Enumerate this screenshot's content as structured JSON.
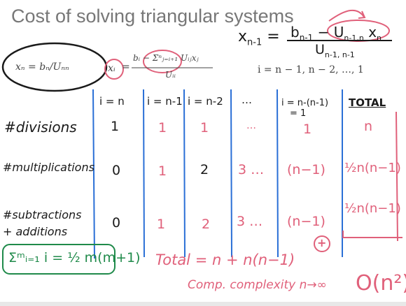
{
  "slide": {
    "title": "Cost of solving triangular systems",
    "top_formula": {
      "lhs": "x",
      "lhs_sub": "n-1",
      "numerator": "b",
      "numerator_sub": "n-1",
      "minus": "−",
      "num_U": "U",
      "num_U_sub": "n-1,n",
      "num_x": "x",
      "num_x_sub": "n",
      "denominator": "U",
      "denominator_sub": "n-1, n-1"
    },
    "formula_xn": "xₙ = bₙ/Uₙₙ",
    "formula_xi_lhs": "xᵢ",
    "formula_xi_num": "bᵢ − Σⁿⱼ₌ᵢ₊₁ Uᵢⱼxⱼ",
    "formula_xi_den": "Uᵢᵢ",
    "formula_range": "i = n − 1, n − 2, …, 1",
    "headers": [
      "i = n",
      "i = n-1",
      "i = n-2",
      "…",
      "i = n-(n-1)",
      "TOTAL"
    ],
    "header_sub": "= 1",
    "rows": [
      {
        "label": "#divisions",
        "cells": [
          "1",
          "1",
          "1",
          "…",
          "1",
          "n"
        ]
      },
      {
        "label": "#multiplications",
        "cells": [
          "0",
          "1",
          "2",
          "3 …",
          "(n−1)",
          "½n(n−1)"
        ]
      },
      {
        "label": "#subtractions",
        "label2": "+ additions",
        "cells": [
          "0",
          "1",
          "2",
          "3 …",
          "(n−1)",
          "½n(n−1)"
        ]
      }
    ],
    "plus_mark": "+",
    "sum_formula": "Σᵐᵢ₌₁ i = ½ m(m+1)",
    "total_line": "Total = n + n(n−1)",
    "complexity_line": "Comp. complexity n→∞",
    "big_o": "O(n²)",
    "colors": {
      "ink": "#1a1a1a",
      "pink": "#e0607a",
      "green": "#1f8a4a",
      "blue": "#2a6fd6"
    }
  }
}
